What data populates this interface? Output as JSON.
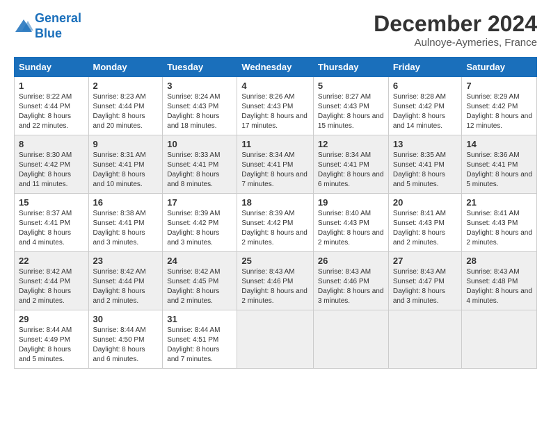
{
  "header": {
    "logo_line1": "General",
    "logo_line2": "Blue",
    "month": "December 2024",
    "location": "Aulnoye-Aymeries, France"
  },
  "columns": [
    "Sunday",
    "Monday",
    "Tuesday",
    "Wednesday",
    "Thursday",
    "Friday",
    "Saturday"
  ],
  "weeks": [
    [
      {
        "day": "1",
        "sunrise": "8:22 AM",
        "sunset": "4:44 PM",
        "daylight": "8 hours and 22 minutes."
      },
      {
        "day": "2",
        "sunrise": "8:23 AM",
        "sunset": "4:44 PM",
        "daylight": "8 hours and 20 minutes."
      },
      {
        "day": "3",
        "sunrise": "8:24 AM",
        "sunset": "4:43 PM",
        "daylight": "8 hours and 18 minutes."
      },
      {
        "day": "4",
        "sunrise": "8:26 AM",
        "sunset": "4:43 PM",
        "daylight": "8 hours and 17 minutes."
      },
      {
        "day": "5",
        "sunrise": "8:27 AM",
        "sunset": "4:43 PM",
        "daylight": "8 hours and 15 minutes."
      },
      {
        "day": "6",
        "sunrise": "8:28 AM",
        "sunset": "4:42 PM",
        "daylight": "8 hours and 14 minutes."
      },
      {
        "day": "7",
        "sunrise": "8:29 AM",
        "sunset": "4:42 PM",
        "daylight": "8 hours and 12 minutes."
      }
    ],
    [
      {
        "day": "8",
        "sunrise": "8:30 AM",
        "sunset": "4:42 PM",
        "daylight": "8 hours and 11 minutes."
      },
      {
        "day": "9",
        "sunrise": "8:31 AM",
        "sunset": "4:41 PM",
        "daylight": "8 hours and 10 minutes."
      },
      {
        "day": "10",
        "sunrise": "8:33 AM",
        "sunset": "4:41 PM",
        "daylight": "8 hours and 8 minutes."
      },
      {
        "day": "11",
        "sunrise": "8:34 AM",
        "sunset": "4:41 PM",
        "daylight": "8 hours and 7 minutes."
      },
      {
        "day": "12",
        "sunrise": "8:34 AM",
        "sunset": "4:41 PM",
        "daylight": "8 hours and 6 minutes."
      },
      {
        "day": "13",
        "sunrise": "8:35 AM",
        "sunset": "4:41 PM",
        "daylight": "8 hours and 5 minutes."
      },
      {
        "day": "14",
        "sunrise": "8:36 AM",
        "sunset": "4:41 PM",
        "daylight": "8 hours and 5 minutes."
      }
    ],
    [
      {
        "day": "15",
        "sunrise": "8:37 AM",
        "sunset": "4:41 PM",
        "daylight": "8 hours and 4 minutes."
      },
      {
        "day": "16",
        "sunrise": "8:38 AM",
        "sunset": "4:41 PM",
        "daylight": "8 hours and 3 minutes."
      },
      {
        "day": "17",
        "sunrise": "8:39 AM",
        "sunset": "4:42 PM",
        "daylight": "8 hours and 3 minutes."
      },
      {
        "day": "18",
        "sunrise": "8:39 AM",
        "sunset": "4:42 PM",
        "daylight": "8 hours and 2 minutes."
      },
      {
        "day": "19",
        "sunrise": "8:40 AM",
        "sunset": "4:43 PM",
        "daylight": "8 hours and 2 minutes."
      },
      {
        "day": "20",
        "sunrise": "8:41 AM",
        "sunset": "4:43 PM",
        "daylight": "8 hours and 2 minutes."
      },
      {
        "day": "21",
        "sunrise": "8:41 AM",
        "sunset": "4:43 PM",
        "daylight": "8 hours and 2 minutes."
      }
    ],
    [
      {
        "day": "22",
        "sunrise": "8:42 AM",
        "sunset": "4:44 PM",
        "daylight": "8 hours and 2 minutes."
      },
      {
        "day": "23",
        "sunrise": "8:42 AM",
        "sunset": "4:44 PM",
        "daylight": "8 hours and 2 minutes."
      },
      {
        "day": "24",
        "sunrise": "8:42 AM",
        "sunset": "4:45 PM",
        "daylight": "8 hours and 2 minutes."
      },
      {
        "day": "25",
        "sunrise": "8:43 AM",
        "sunset": "4:46 PM",
        "daylight": "8 hours and 2 minutes."
      },
      {
        "day": "26",
        "sunrise": "8:43 AM",
        "sunset": "4:46 PM",
        "daylight": "8 hours and 3 minutes."
      },
      {
        "day": "27",
        "sunrise": "8:43 AM",
        "sunset": "4:47 PM",
        "daylight": "8 hours and 3 minutes."
      },
      {
        "day": "28",
        "sunrise": "8:43 AM",
        "sunset": "4:48 PM",
        "daylight": "8 hours and 4 minutes."
      }
    ],
    [
      {
        "day": "29",
        "sunrise": "8:44 AM",
        "sunset": "4:49 PM",
        "daylight": "8 hours and 5 minutes."
      },
      {
        "day": "30",
        "sunrise": "8:44 AM",
        "sunset": "4:50 PM",
        "daylight": "8 hours and 6 minutes."
      },
      {
        "day": "31",
        "sunrise": "8:44 AM",
        "sunset": "4:51 PM",
        "daylight": "8 hours and 7 minutes."
      },
      null,
      null,
      null,
      null
    ]
  ]
}
